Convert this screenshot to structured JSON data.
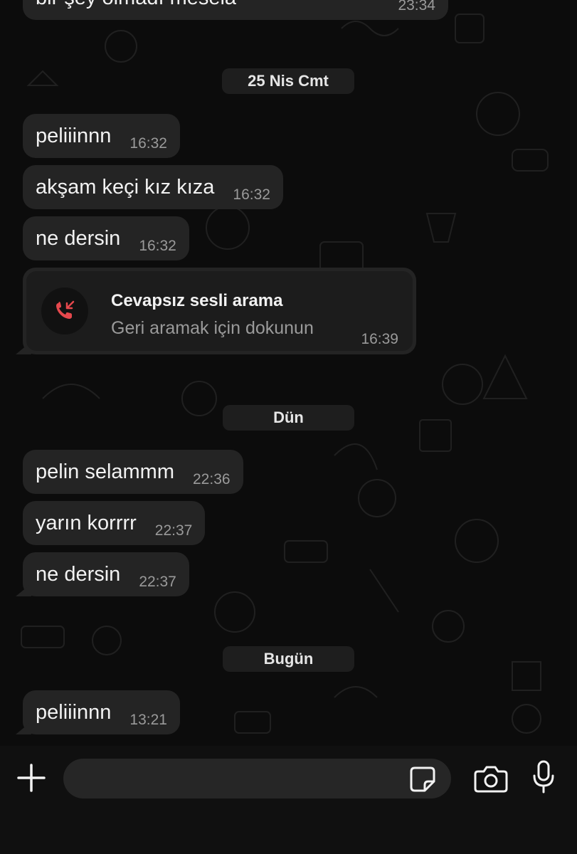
{
  "chat": {
    "partial_top_message": {
      "text": "bir şey olmadı mesela",
      "time": "23:34"
    },
    "sections": [
      {
        "date": "25 Nis Cmt",
        "messages": [
          {
            "text": "peliiinnn",
            "time": "16:32"
          },
          {
            "text": "akşam keçi kız kıza",
            "time": "16:32"
          },
          {
            "text": "ne dersin",
            "time": "16:32"
          }
        ],
        "missed_call": {
          "title": "Cevapsız sesli arama",
          "subtitle": "Geri aramak için dokunun",
          "time": "16:39",
          "icon": "missed-call-icon",
          "icon_color": "#e5484d"
        }
      },
      {
        "date": "Dün",
        "messages": [
          {
            "text": "pelin selammm",
            "time": "22:36"
          },
          {
            "text": "yarın korrrr",
            "time": "22:37"
          },
          {
            "text": "ne dersin",
            "time": "22:37"
          }
        ]
      },
      {
        "date": "Bugün",
        "messages": [
          {
            "text": "peliiinnn",
            "time": "13:21"
          }
        ]
      }
    ]
  },
  "input_bar": {
    "message_value": "",
    "icons": [
      "plus-icon",
      "sticker-icon",
      "camera-icon",
      "microphone-icon"
    ]
  },
  "colors": {
    "background": "#0c0c0c",
    "bubble": "#242424",
    "text": "#f2f2f2",
    "muted": "#9a9a9a"
  }
}
